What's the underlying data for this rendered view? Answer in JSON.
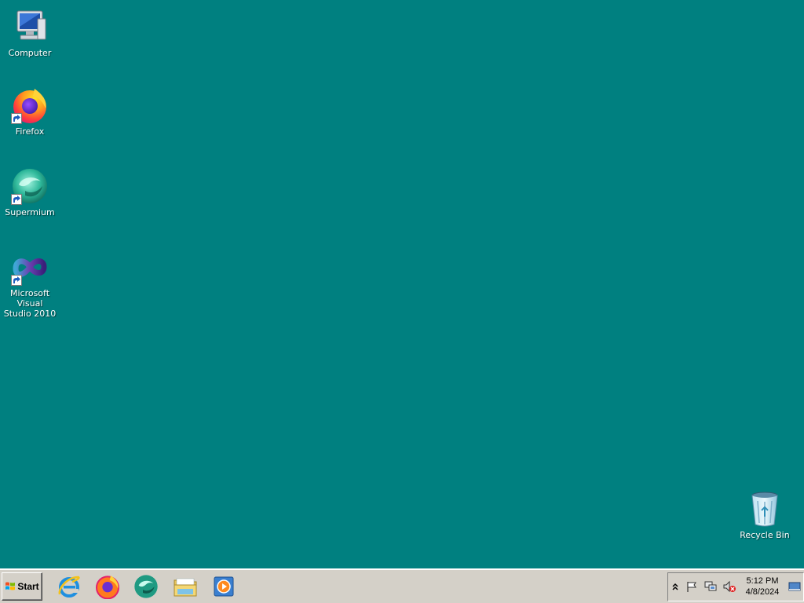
{
  "desktop": {
    "background_color": "#008080",
    "icons": [
      {
        "label": "Computer",
        "icon": "computer-icon",
        "shortcut": false
      },
      {
        "label": "Firefox",
        "icon": "firefox-icon",
        "shortcut": true
      },
      {
        "label": "Supermium",
        "icon": "supermium-icon",
        "shortcut": true
      },
      {
        "label": "Microsoft Visual\nStudio 2010",
        "icon": "visual-studio-icon",
        "shortcut": true
      },
      {
        "label": "Recycle Bin",
        "icon": "recycle-bin-icon",
        "shortcut": false
      }
    ]
  },
  "taskbar": {
    "start_label": "Start",
    "quick_launch": [
      {
        "name": "Internet Explorer",
        "icon": "internet-explorer-icon"
      },
      {
        "name": "Firefox",
        "icon": "firefox-icon"
      },
      {
        "name": "Supermium",
        "icon": "supermium-icon"
      },
      {
        "name": "Windows Explorer",
        "icon": "folder-icon"
      },
      {
        "name": "Media Player",
        "icon": "media-player-icon"
      }
    ],
    "tray": {
      "icons": [
        "show-hidden-icons-chevron",
        "action-center-flag-icon",
        "network-icon",
        "volume-muted-icon",
        "show-desktop-icon"
      ],
      "time": "5:12 PM",
      "date": "4/8/2024"
    }
  }
}
